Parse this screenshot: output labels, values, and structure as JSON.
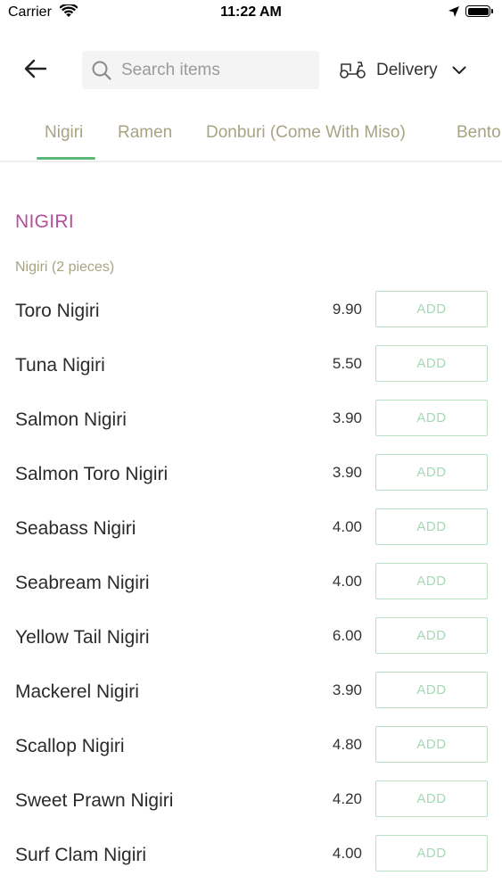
{
  "status_bar": {
    "carrier": "Carrier",
    "time": "11:22 AM"
  },
  "header": {
    "search_placeholder": "Search items",
    "delivery_label": "Delivery"
  },
  "tabs": [
    {
      "label": "Nigiri",
      "active": true
    },
    {
      "label": "Ramen"
    },
    {
      "label": "Donburi (Come With Miso)"
    },
    {
      "label": "Bento"
    }
  ],
  "section": {
    "title": "NIGIRI",
    "subtitle": "Nigiri (2 pieces)"
  },
  "add_label": "ADD",
  "items": [
    {
      "name": "Toro Nigiri",
      "price": "9.90"
    },
    {
      "name": "Tuna Nigiri",
      "price": "5.50"
    },
    {
      "name": "Salmon Nigiri",
      "price": "3.90"
    },
    {
      "name": "Salmon Toro Nigiri",
      "price": "3.90"
    },
    {
      "name": "Seabass Nigiri",
      "price": "4.00"
    },
    {
      "name": "Seabream Nigiri",
      "price": "4.00"
    },
    {
      "name": "Yellow Tail Nigiri",
      "price": "6.00"
    },
    {
      "name": "Mackerel Nigiri",
      "price": "3.90"
    },
    {
      "name": "Scallop Nigiri",
      "price": "4.80"
    },
    {
      "name": "Sweet Prawn Nigiri",
      "price": "4.20"
    },
    {
      "name": "Surf Clam Nigiri",
      "price": "4.00"
    }
  ],
  "colors": {
    "section_title": "#b44f9c",
    "tab_text": "#a8a382",
    "tab_underline": "#5cb878",
    "add_border": "#b9dfc4",
    "add_text": "#a6d8b6"
  }
}
